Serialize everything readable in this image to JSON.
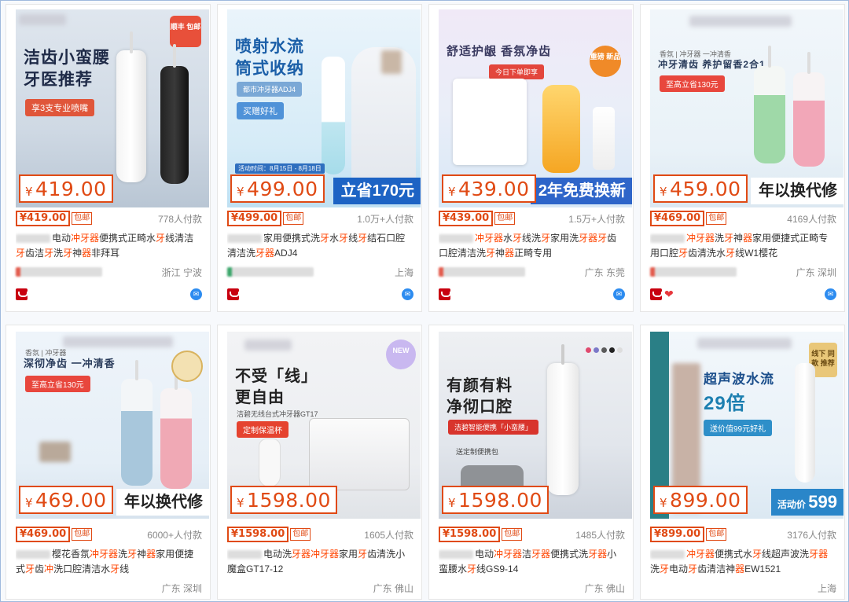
{
  "products": [
    {
      "image": {
        "headline": "洁齿小蛮腰\n牙医推荐",
        "sub": "享3支专业喷嘴",
        "badge": "顺丰\n包邮"
      },
      "price_box": "419.00",
      "price": "419.00",
      "shipping": "包邮",
      "paid_count": "778人付款",
      "title_parts": [
        {
          "text": "电动",
          "hl": false
        },
        {
          "text": "冲牙器",
          "hl": true
        },
        {
          "text": "便携式正畸水",
          "hl": false
        },
        {
          "text": "牙",
          "hl": true
        },
        {
          "text": "线清洁",
          "hl": false
        },
        {
          "text": "牙",
          "hl": true
        },
        {
          "text": "齿洁",
          "hl": false
        },
        {
          "text": "牙",
          "hl": true
        },
        {
          "text": "洗",
          "hl": false
        },
        {
          "text": "牙",
          "hl": true
        },
        {
          "text": "神",
          "hl": false
        },
        {
          "text": "器",
          "hl": true
        },
        {
          "text": "非拜耳",
          "hl": false
        }
      ],
      "location": "浙江 宁波",
      "heart": false
    },
    {
      "image": {
        "headline": "喷射水流\n筒式收纳",
        "sub": "都市冲牙器ADJ4",
        "sub2": "买赠好礼",
        "badge2": "活动时间：8月15日 - 8月18日"
      },
      "price_box": "499.00",
      "promo": "立省170元",
      "price": "499.00",
      "shipping": "包邮",
      "paid_count": "1.0万+人付款",
      "title_parts": [
        {
          "text": "家用便携式洗",
          "hl": false
        },
        {
          "text": "牙",
          "hl": true
        },
        {
          "text": "水",
          "hl": false
        },
        {
          "text": "牙",
          "hl": true
        },
        {
          "text": "线",
          "hl": false
        },
        {
          "text": "牙",
          "hl": true
        },
        {
          "text": "结石口腔清洁洗",
          "hl": false
        },
        {
          "text": "牙器",
          "hl": true
        },
        {
          "text": "ADJ4",
          "hl": false
        }
      ],
      "location": "上海",
      "heart": false
    },
    {
      "image": {
        "headline": "舒适护龈 香氛净齿",
        "sub": "今日下单即享",
        "badge": "重磅\n新品"
      },
      "price_box": "439.00",
      "promo": "2年免费换新",
      "price": "439.00",
      "shipping": "包邮",
      "paid_count": "1.5万+人付款",
      "title_parts": [
        {
          "text": "冲牙器",
          "hl": true
        },
        {
          "text": "水",
          "hl": false
        },
        {
          "text": "牙",
          "hl": true
        },
        {
          "text": "线洗",
          "hl": false
        },
        {
          "text": "牙",
          "hl": true
        },
        {
          "text": "家用洗",
          "hl": false
        },
        {
          "text": "牙器牙",
          "hl": true
        },
        {
          "text": "齿口腔清洁洗",
          "hl": false
        },
        {
          "text": "牙",
          "hl": true
        },
        {
          "text": "神",
          "hl": false
        },
        {
          "text": "器",
          "hl": true
        },
        {
          "text": "正畸专用",
          "hl": false
        }
      ],
      "location": "广东 东莞",
      "heart": false
    },
    {
      "image": {
        "headline": "冲牙清齿 养护留香2合1",
        "sub": "至高立省130元",
        "badge": "香氛 | 冲牙器 一冲清香"
      },
      "price_box": "459.00",
      "promo": "年以换代修",
      "price": "469.00",
      "shipping": "包邮",
      "paid_count": "4169人付款",
      "title_parts": [
        {
          "text": "冲牙器",
          "hl": true
        },
        {
          "text": "洗",
          "hl": false
        },
        {
          "text": "牙",
          "hl": true
        },
        {
          "text": "神",
          "hl": false
        },
        {
          "text": "器",
          "hl": true
        },
        {
          "text": "家用便捷式正畸专用口腔",
          "hl": false
        },
        {
          "text": "牙",
          "hl": true
        },
        {
          "text": "齿清洗水",
          "hl": false
        },
        {
          "text": "牙",
          "hl": true
        },
        {
          "text": "线W1樱花",
          "hl": false
        }
      ],
      "location": "广东 深圳",
      "heart": true
    },
    {
      "image": {
        "headline": "深彻净齿 一冲清香",
        "sub": "至高立省130元",
        "badge": "香氛 | 冲牙器"
      },
      "price_box": "469.00",
      "promo": "年以换代修",
      "price": "469.00",
      "shipping": "包邮",
      "paid_count": "6000+人付款",
      "title_parts": [
        {
          "text": "樱花香氛",
          "hl": false
        },
        {
          "text": "冲牙器",
          "hl": true
        },
        {
          "text": "洗",
          "hl": false
        },
        {
          "text": "牙",
          "hl": true
        },
        {
          "text": "神",
          "hl": false
        },
        {
          "text": "器",
          "hl": true
        },
        {
          "text": "家用便捷式",
          "hl": false
        },
        {
          "text": "牙",
          "hl": true
        },
        {
          "text": "齿",
          "hl": false
        },
        {
          "text": "冲",
          "hl": true
        },
        {
          "text": "洗口腔清洁水",
          "hl": false
        },
        {
          "text": "牙",
          "hl": true
        },
        {
          "text": "线",
          "hl": false
        }
      ],
      "location": "广东 深圳",
      "heart": false
    },
    {
      "image": {
        "headline": "不受「线」\n更自由",
        "sub": "定制保温杯",
        "badge": "NEW",
        "sub3": "洁碧无线台式冲牙器GT17"
      },
      "price_box": "1598.00",
      "price": "1598.00",
      "shipping": "包邮",
      "paid_count": "1605人付款",
      "title_parts": [
        {
          "text": "电动洗",
          "hl": false
        },
        {
          "text": "牙器冲牙器",
          "hl": true
        },
        {
          "text": "家用",
          "hl": false
        },
        {
          "text": "牙",
          "hl": true
        },
        {
          "text": "齿清洗小魔盒GT17-12",
          "hl": false
        }
      ],
      "location": "广东 佛山",
      "heart": false
    },
    {
      "image": {
        "headline": "有颜有料\n净彻口腔",
        "sub": "洁碧智能便携「小蛮腰」",
        "sub3": "送定制便携包"
      },
      "price_box": "1598.00",
      "price": "1598.00",
      "shipping": "包邮",
      "paid_count": "1485人付款",
      "title_parts": [
        {
          "text": "电动",
          "hl": false
        },
        {
          "text": "冲牙器",
          "hl": true
        },
        {
          "text": "洁",
          "hl": false
        },
        {
          "text": "牙器",
          "hl": true
        },
        {
          "text": "便携式洗",
          "hl": false
        },
        {
          "text": "牙器",
          "hl": true
        },
        {
          "text": "小蛮腰水",
          "hl": false
        },
        {
          "text": "牙",
          "hl": true
        },
        {
          "text": "线GS9-14",
          "hl": false
        }
      ],
      "location": "广东 佛山",
      "heart": false
    },
    {
      "image": {
        "headline": "超声波水流",
        "big": "29倍",
        "sub": "送价值99元好礼",
        "badge": "线下\n同款\n推荐",
        "promo_small": "活动价",
        "promo_big": "599"
      },
      "price_box": "899.00",
      "price": "899.00",
      "shipping": "包邮",
      "paid_count": "3176人付款",
      "title_parts": [
        {
          "text": "冲牙器",
          "hl": true
        },
        {
          "text": "便携式水",
          "hl": false
        },
        {
          "text": "牙",
          "hl": true
        },
        {
          "text": "线超声波洗",
          "hl": false
        },
        {
          "text": "牙器",
          "hl": true
        },
        {
          "text": "洗",
          "hl": false
        },
        {
          "text": "牙",
          "hl": true
        },
        {
          "text": "电动",
          "hl": false
        },
        {
          "text": "牙",
          "hl": true
        },
        {
          "text": "齿清洁神",
          "hl": false
        },
        {
          "text": "器",
          "hl": true
        },
        {
          "text": "EW1521",
          "hl": false
        }
      ],
      "location": "上海",
      "heart": false
    }
  ],
  "colors": {
    "price": "#e04a14",
    "highlight": "#ff4400",
    "border": "#9fb9dd"
  }
}
